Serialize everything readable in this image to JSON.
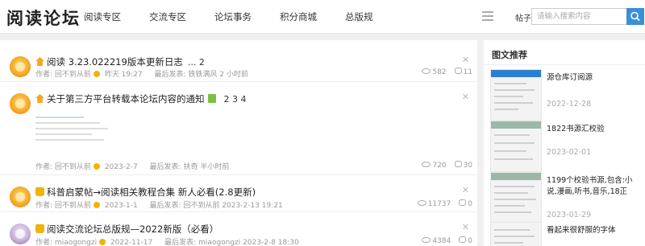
{
  "header": {
    "logo": "阅读论坛",
    "nav": [
      "阅读专区",
      "交流专区",
      "论坛事务",
      "积分商城",
      "总版规"
    ],
    "search_type": "帖子",
    "search_placeholder": "请输入搜索内容"
  },
  "threads": [
    {
      "title": "阅读 3.23.022219版本更新日志",
      "pages": "... 2",
      "author_label": "作者:",
      "author": "回不到从前",
      "date": "昨天 19:27",
      "last_label": "最后发表:",
      "last": "铁铁满风  2 小时前",
      "views": "582",
      "replies": "11"
    },
    {
      "title": "关于第三方平台转载本论坛内容的通知",
      "pages": "2  3  4",
      "author_label": "作者:",
      "author": "回不到从前",
      "date": "2023-2-7",
      "last_label": "最后发表:",
      "last": "扶奇  半小时前",
      "views": "720",
      "replies": "30"
    },
    {
      "title": "科普启蒙帖→阅读相关教程合集 新人必看(2.8更新)",
      "pages": "",
      "author_label": "作者:",
      "author": "回不到从前",
      "date": "2023-1-1",
      "last_label": "最后发表:",
      "last": "回不到从前  2023-2-13 19:21",
      "views": "11737",
      "replies": "0"
    },
    {
      "title": "阅读交流论坛总版规—2022新版（必看）",
      "pages": "",
      "author_label": "作者:",
      "author": "miaogongzi",
      "date": "2022-11-17",
      "last_label": "最后发表:",
      "last": "miaogongzi  2023-2-8 18:30",
      "views": "4384",
      "replies": "0"
    }
  ],
  "sidebar": {
    "title": "图文推荐",
    "items": [
      {
        "text": "源仓库订阅源",
        "date": "2022-12-28"
      },
      {
        "text": "1822书源汇校验",
        "date": "2023-02-01"
      },
      {
        "text": "1199个校验书源,包含:小说,漫画,听书,音乐,18正",
        "date": "2023-01-29"
      },
      {
        "text": "看起来很舒服的字体",
        "date": ""
      }
    ]
  },
  "colors": {
    "accent": "#3b8fd6",
    "pin": "#f6a623"
  }
}
